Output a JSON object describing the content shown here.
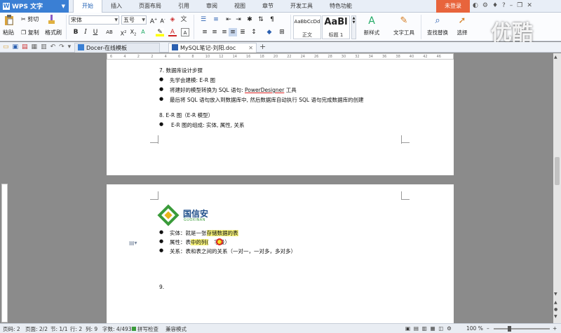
{
  "app": {
    "name": "WPS 文字",
    "login": "未登录"
  },
  "menu": {
    "tabs": [
      "开始",
      "插入",
      "页面布局",
      "引用",
      "审阅",
      "视图",
      "章节",
      "开发工具",
      "特色功能"
    ]
  },
  "ribbon": {
    "paste": "粘贴",
    "cut": "剪切",
    "copy": "复制",
    "format_painter": "格式刷",
    "font_name": "宋体",
    "font_size": "五号",
    "styles": [
      {
        "sample": "AaBbCcDd",
        "name": "正文"
      },
      {
        "sample": "AaBl",
        "name": "标题 1"
      }
    ],
    "new_style": "新样式",
    "text_tool": "文字工具",
    "find_replace": "查找替换",
    "select": "选择"
  },
  "doc_tabs": [
    {
      "label": "Docer-在线模板"
    },
    {
      "label": "MySQL笔记-刘阳.doc"
    }
  ],
  "ruler": {
    "numbers": [
      "6",
      "4",
      "2",
      "2",
      "4",
      "6",
      "8",
      "10",
      "12",
      "14",
      "16",
      "18",
      "20",
      "22",
      "24",
      "26",
      "28",
      "30",
      "32",
      "34",
      "36",
      "38",
      "40",
      "42",
      "46"
    ]
  },
  "page1": {
    "lines": [
      "7.  数据库设计步骤",
      "先学会建模: E-R 图",
      "将建好的模型转换为 SQL 语句: ",
      "PowerDesigner",
      " 工具",
      "最后将 SQL 语句放入到数据库中, 然后数据库自动执行 SQL 语句完成数据库的创建",
      "8.  E-R 图（E-R 模型）",
      "E-R 图的组成: 实体, 属性, 关系"
    ]
  },
  "page2": {
    "logo_text": "国信安",
    "logo_sub": "GUOXINAN",
    "bullets": [
      {
        "a": "实体：就是一张",
        "b": "存储数据的表",
        "c": ""
      },
      {
        "a": "属性：表",
        "b": "中的列(",
        "c": "字段）"
      },
      {
        "a": "关系：表和表之间的关系（一对一，一对多，多对多）",
        "b": "",
        "c": ""
      }
    ],
    "item9": "9."
  },
  "status": {
    "page": "页码: 2",
    "pages": "页面: 2/2",
    "section": "节: 1/1",
    "line": "行: 2",
    "col": "列: 9",
    "words": "字数: 4/493",
    "spell": "拼写检查",
    "mode": "兼容模式",
    "zoom": "100 %"
  },
  "watermark": "优酷"
}
